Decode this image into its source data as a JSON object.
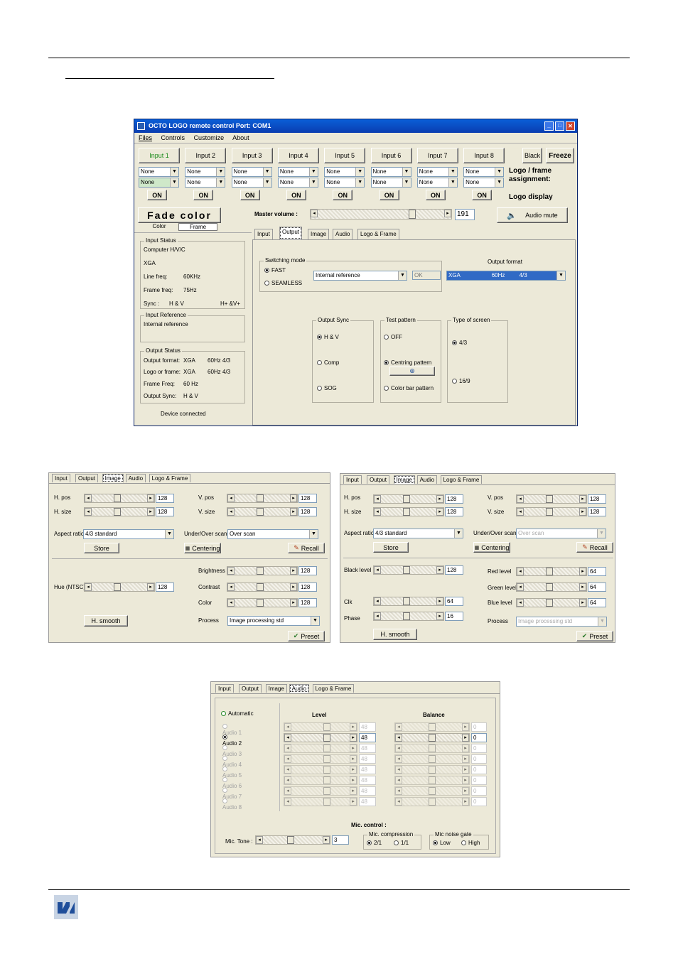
{
  "main_window": {
    "title": "OCTO LOGO remote control  Port: COM1",
    "menu": [
      "Files",
      "Controls",
      "Customize",
      "About"
    ],
    "inputs": [
      "Input 1",
      "Input 2",
      "Input 3",
      "Input 4",
      "Input 5",
      "Input 6",
      "Input 7",
      "Input 8"
    ],
    "black": "Black",
    "freeze": "Freeze",
    "logo_select": "None",
    "on_label": "ON",
    "logo_frame_assignment": "Logo / frame assignment:",
    "logo_display": "Logo display",
    "fade_color": "Fade color",
    "color_tab": "Color",
    "frame_tab": "Frame",
    "master_volume_label": "Master volume :",
    "master_volume_value": "191",
    "audio_mute": "Audio mute",
    "tabs": [
      "Input",
      "Output",
      "Image",
      "Audio",
      "Logo & Frame"
    ],
    "input_status": {
      "title": "Input Status",
      "source": "Computer H/V/C",
      "format": "XGA",
      "line_freq_label": "Line freq:",
      "line_freq": "60KHz",
      "frame_freq_label": "Frame freq:",
      "frame_freq": "75Hz",
      "sync_label": "Sync :",
      "sync": "H & V",
      "sync_pol": "H+ &V+"
    },
    "input_reference": {
      "title": "Input Reference",
      "value": "Internal reference"
    },
    "output_status": {
      "title": "Output Status",
      "format_label": "Output format:",
      "format": "XGA",
      "format_rate": "60Hz  4/3",
      "logo_label": "Logo or frame:",
      "logo": "XGA",
      "logo_rate": "60Hz  4/3",
      "frame_freq_label": "Frame Freq:",
      "frame_freq": "60 Hz",
      "sync_label": "Output Sync:",
      "sync": "H & V"
    },
    "device_connected": "Device connected",
    "switching_mode": {
      "title": "Switching mode",
      "fast": "FAST",
      "seamless": "SEAMLESS",
      "reference": "Internal reference",
      "ok": "OK"
    },
    "output_format": {
      "title": "Output format",
      "v1": "XGA",
      "v2": "60Hz",
      "v3": "4/3"
    },
    "output_sync": {
      "title": "Output Sync",
      "o1": "H & V",
      "o2": "Comp",
      "o3": "SOG"
    },
    "test_pattern": {
      "title": "Test pattern",
      "o1": "OFF",
      "o2": "Centring pattern",
      "o3": "Color bar pattern"
    },
    "type_of_screen": {
      "title": "Type of screen",
      "o1": "4/3",
      "o2": "16/9"
    }
  },
  "image_left": {
    "tabs": [
      "Input",
      "Output",
      "Image",
      "Audio",
      "Logo & Frame"
    ],
    "hpos": "H. pos",
    "hpos_v": "128",
    "hsize": "H. size",
    "hsize_v": "128",
    "vpos": "V. pos",
    "vpos_v": "128",
    "vsize": "V. size",
    "vsize_v": "128",
    "aspect": "Aspect ratio",
    "aspect_v": "4/3 standard",
    "scan": "Under/Over scan",
    "scan_v": "Over   scan",
    "store": "Store",
    "centering": "Centering",
    "recall": "Recall",
    "brightness": "Brightness",
    "brightness_v": "128",
    "contrast": "Contrast",
    "contrast_v": "128",
    "color": "Color",
    "color_v": "128",
    "hue": "Hue (NTSC)",
    "hue_v": "128",
    "hsmooth": "H. smooth",
    "process": "Process",
    "process_v": "Image processing std",
    "preset": "Preset"
  },
  "image_right": {
    "tabs": [
      "Input",
      "Output",
      "Image",
      "Audio",
      "Logo & Frame"
    ],
    "hpos": "H. pos",
    "hpos_v": "128",
    "hsize": "H. size",
    "hsize_v": "128",
    "vpos": "V. pos",
    "vpos_v": "128",
    "vsize": "V. size",
    "vsize_v": "128",
    "aspect": "Aspect ratio",
    "aspect_v": "4/3 standard",
    "scan": "Under/Over scan",
    "scan_v": "Over   scan",
    "store": "Store",
    "centering": "Centering",
    "recall": "Recall",
    "black": "Black level",
    "black_v": "128",
    "red": "Red level",
    "red_v": "64",
    "green": "Green level",
    "green_v": "64",
    "blue": "Blue level",
    "blue_v": "64",
    "clk": "Clk",
    "clk_v": "64",
    "phase": "Phase",
    "phase_v": "16",
    "hsmooth": "H. smooth",
    "process": "Process",
    "process_v": "Image processing std",
    "preset": "Preset"
  },
  "audio_panel": {
    "tabs": [
      "Input",
      "Output",
      "Image",
      "Audio",
      "Logo & Frame"
    ],
    "automatic": "Automatic",
    "audios": [
      "Audio 1",
      "Audio 2",
      "Audio 3",
      "Audio 4",
      "Audio 5",
      "Audio 6",
      "Audio 7",
      "Audio 8"
    ],
    "level": "Level",
    "balance": "Balance",
    "level_value": "48",
    "balance_value": "0",
    "mic_control": "Mic. control :",
    "mic_tone": "Mic. Tone :",
    "mic_tone_v": "3",
    "mic_compression": "Mic. compression",
    "c1": "2/1",
    "c2": "1/1",
    "mic_noise_gate": "Mic noise gate",
    "g1": "Low",
    "g2": "High"
  },
  "colors": {
    "window_bg": "#ece9d8",
    "titlebar": "#0a246a",
    "logo": "#1f4e9a"
  }
}
